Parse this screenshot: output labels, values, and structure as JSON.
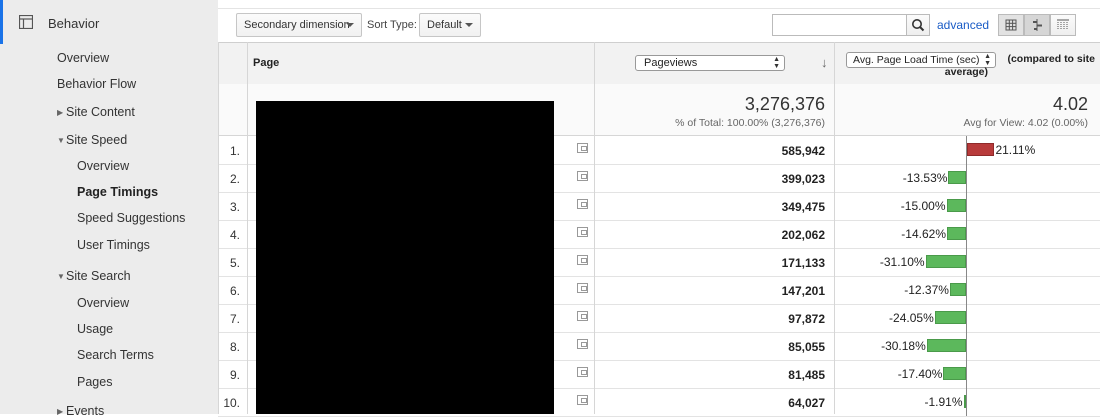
{
  "sidebar": {
    "section_title": "Behavior",
    "items": [
      {
        "label": "Overview"
      },
      {
        "label": "Behavior Flow"
      },
      {
        "label": "Site Content"
      },
      {
        "label": "Site Speed"
      },
      {
        "label": "Overview"
      },
      {
        "label": "Page Timings"
      },
      {
        "label": "Speed Suggestions"
      },
      {
        "label": "User Timings"
      },
      {
        "label": "Site Search"
      },
      {
        "label": "Overview"
      },
      {
        "label": "Usage"
      },
      {
        "label": "Search Terms"
      },
      {
        "label": "Pages"
      },
      {
        "label": "Events"
      }
    ],
    "active_item": "Page Timings",
    "accent_color": "#1a73e8"
  },
  "toolbar": {
    "secondary_dimension": "Secondary dimension",
    "sort_type_label": "Sort Type:",
    "sort_type_value": "Default",
    "search_placeholder": "",
    "search_icon": "search-icon",
    "advanced_link": "advanced",
    "views": [
      "table-view-icon",
      "comparison-view-icon",
      "pivot-view-icon"
    ]
  },
  "table": {
    "col_page": "Page",
    "col_metric": "Pageviews",
    "col_compare": "Avg. Page Load Time (sec)",
    "compare_note_line1": "(compared to site",
    "compare_note_line2": "average)",
    "total_value": "3,276,376",
    "total_sub": "% of Total: 100.00% (3,276,376)",
    "avg_value": "4.02",
    "avg_sub": "Avg for View: 4.02 (0.00%)",
    "positive_color": "#b83b3b",
    "negative_color": "#5cb85c",
    "rows": [
      {
        "num": "1.",
        "pageviews": "585,942",
        "pct_label": "21.11%",
        "pct": 21.11
      },
      {
        "num": "2.",
        "pageviews": "399,023",
        "pct_label": "-13.53%",
        "pct": -13.53
      },
      {
        "num": "3.",
        "pageviews": "349,475",
        "pct_label": "-15.00%",
        "pct": -15.0
      },
      {
        "num": "4.",
        "pageviews": "202,062",
        "pct_label": "-14.62%",
        "pct": -14.62
      },
      {
        "num": "5.",
        "pageviews": "171,133",
        "pct_label": "-31.10%",
        "pct": -31.1
      },
      {
        "num": "6.",
        "pageviews": "147,201",
        "pct_label": "-12.37%",
        "pct": -12.37
      },
      {
        "num": "7.",
        "pageviews": "97,872",
        "pct_label": "-24.05%",
        "pct": -24.05
      },
      {
        "num": "8.",
        "pageviews": "85,055",
        "pct_label": "-30.18%",
        "pct": -30.18
      },
      {
        "num": "9.",
        "pageviews": "81,485",
        "pct_label": "-17.40%",
        "pct": -17.4
      },
      {
        "num": "10.",
        "pageviews": "64,027",
        "pct_label": "-1.91%",
        "pct": -1.91
      }
    ]
  }
}
